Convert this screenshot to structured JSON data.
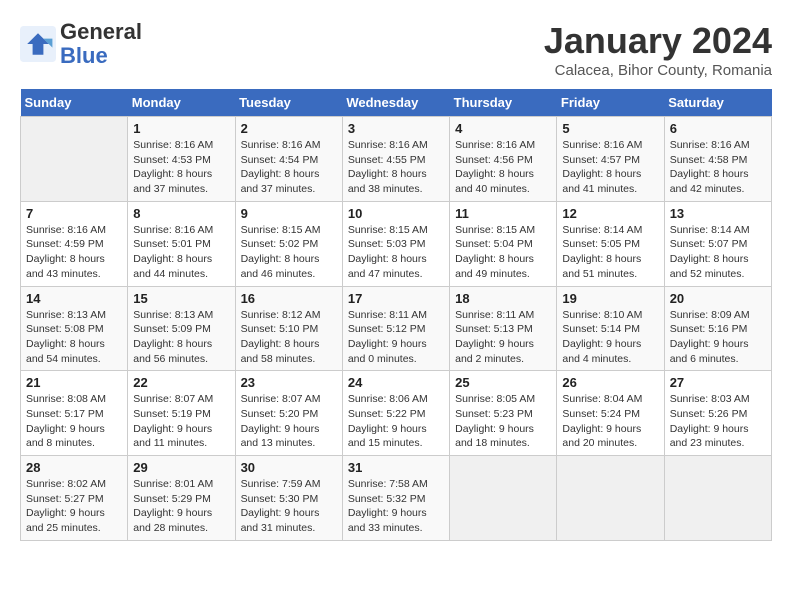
{
  "header": {
    "logo_line1": "General",
    "logo_line2": "Blue",
    "month": "January 2024",
    "location": "Calacea, Bihor County, Romania"
  },
  "days_of_week": [
    "Sunday",
    "Monday",
    "Tuesday",
    "Wednesday",
    "Thursday",
    "Friday",
    "Saturday"
  ],
  "weeks": [
    [
      {
        "day": "",
        "empty": true
      },
      {
        "day": "1",
        "sunrise": "Sunrise: 8:16 AM",
        "sunset": "Sunset: 4:53 PM",
        "daylight": "Daylight: 8 hours and 37 minutes."
      },
      {
        "day": "2",
        "sunrise": "Sunrise: 8:16 AM",
        "sunset": "Sunset: 4:54 PM",
        "daylight": "Daylight: 8 hours and 37 minutes."
      },
      {
        "day": "3",
        "sunrise": "Sunrise: 8:16 AM",
        "sunset": "Sunset: 4:55 PM",
        "daylight": "Daylight: 8 hours and 38 minutes."
      },
      {
        "day": "4",
        "sunrise": "Sunrise: 8:16 AM",
        "sunset": "Sunset: 4:56 PM",
        "daylight": "Daylight: 8 hours and 40 minutes."
      },
      {
        "day": "5",
        "sunrise": "Sunrise: 8:16 AM",
        "sunset": "Sunset: 4:57 PM",
        "daylight": "Daylight: 8 hours and 41 minutes."
      },
      {
        "day": "6",
        "sunrise": "Sunrise: 8:16 AM",
        "sunset": "Sunset: 4:58 PM",
        "daylight": "Daylight: 8 hours and 42 minutes."
      }
    ],
    [
      {
        "day": "7",
        "sunrise": "Sunrise: 8:16 AM",
        "sunset": "Sunset: 4:59 PM",
        "daylight": "Daylight: 8 hours and 43 minutes."
      },
      {
        "day": "8",
        "sunrise": "Sunrise: 8:16 AM",
        "sunset": "Sunset: 5:01 PM",
        "daylight": "Daylight: 8 hours and 44 minutes."
      },
      {
        "day": "9",
        "sunrise": "Sunrise: 8:15 AM",
        "sunset": "Sunset: 5:02 PM",
        "daylight": "Daylight: 8 hours and 46 minutes."
      },
      {
        "day": "10",
        "sunrise": "Sunrise: 8:15 AM",
        "sunset": "Sunset: 5:03 PM",
        "daylight": "Daylight: 8 hours and 47 minutes."
      },
      {
        "day": "11",
        "sunrise": "Sunrise: 8:15 AM",
        "sunset": "Sunset: 5:04 PM",
        "daylight": "Daylight: 8 hours and 49 minutes."
      },
      {
        "day": "12",
        "sunrise": "Sunrise: 8:14 AM",
        "sunset": "Sunset: 5:05 PM",
        "daylight": "Daylight: 8 hours and 51 minutes."
      },
      {
        "day": "13",
        "sunrise": "Sunrise: 8:14 AM",
        "sunset": "Sunset: 5:07 PM",
        "daylight": "Daylight: 8 hours and 52 minutes."
      }
    ],
    [
      {
        "day": "14",
        "sunrise": "Sunrise: 8:13 AM",
        "sunset": "Sunset: 5:08 PM",
        "daylight": "Daylight: 8 hours and 54 minutes."
      },
      {
        "day": "15",
        "sunrise": "Sunrise: 8:13 AM",
        "sunset": "Sunset: 5:09 PM",
        "daylight": "Daylight: 8 hours and 56 minutes."
      },
      {
        "day": "16",
        "sunrise": "Sunrise: 8:12 AM",
        "sunset": "Sunset: 5:10 PM",
        "daylight": "Daylight: 8 hours and 58 minutes."
      },
      {
        "day": "17",
        "sunrise": "Sunrise: 8:11 AM",
        "sunset": "Sunset: 5:12 PM",
        "daylight": "Daylight: 9 hours and 0 minutes."
      },
      {
        "day": "18",
        "sunrise": "Sunrise: 8:11 AM",
        "sunset": "Sunset: 5:13 PM",
        "daylight": "Daylight: 9 hours and 2 minutes."
      },
      {
        "day": "19",
        "sunrise": "Sunrise: 8:10 AM",
        "sunset": "Sunset: 5:14 PM",
        "daylight": "Daylight: 9 hours and 4 minutes."
      },
      {
        "day": "20",
        "sunrise": "Sunrise: 8:09 AM",
        "sunset": "Sunset: 5:16 PM",
        "daylight": "Daylight: 9 hours and 6 minutes."
      }
    ],
    [
      {
        "day": "21",
        "sunrise": "Sunrise: 8:08 AM",
        "sunset": "Sunset: 5:17 PM",
        "daylight": "Daylight: 9 hours and 8 minutes."
      },
      {
        "day": "22",
        "sunrise": "Sunrise: 8:07 AM",
        "sunset": "Sunset: 5:19 PM",
        "daylight": "Daylight: 9 hours and 11 minutes."
      },
      {
        "day": "23",
        "sunrise": "Sunrise: 8:07 AM",
        "sunset": "Sunset: 5:20 PM",
        "daylight": "Daylight: 9 hours and 13 minutes."
      },
      {
        "day": "24",
        "sunrise": "Sunrise: 8:06 AM",
        "sunset": "Sunset: 5:22 PM",
        "daylight": "Daylight: 9 hours and 15 minutes."
      },
      {
        "day": "25",
        "sunrise": "Sunrise: 8:05 AM",
        "sunset": "Sunset: 5:23 PM",
        "daylight": "Daylight: 9 hours and 18 minutes."
      },
      {
        "day": "26",
        "sunrise": "Sunrise: 8:04 AM",
        "sunset": "Sunset: 5:24 PM",
        "daylight": "Daylight: 9 hours and 20 minutes."
      },
      {
        "day": "27",
        "sunrise": "Sunrise: 8:03 AM",
        "sunset": "Sunset: 5:26 PM",
        "daylight": "Daylight: 9 hours and 23 minutes."
      }
    ],
    [
      {
        "day": "28",
        "sunrise": "Sunrise: 8:02 AM",
        "sunset": "Sunset: 5:27 PM",
        "daylight": "Daylight: 9 hours and 25 minutes."
      },
      {
        "day": "29",
        "sunrise": "Sunrise: 8:01 AM",
        "sunset": "Sunset: 5:29 PM",
        "daylight": "Daylight: 9 hours and 28 minutes."
      },
      {
        "day": "30",
        "sunrise": "Sunrise: 7:59 AM",
        "sunset": "Sunset: 5:30 PM",
        "daylight": "Daylight: 9 hours and 31 minutes."
      },
      {
        "day": "31",
        "sunrise": "Sunrise: 7:58 AM",
        "sunset": "Sunset: 5:32 PM",
        "daylight": "Daylight: 9 hours and 33 minutes."
      },
      {
        "day": "",
        "empty": true
      },
      {
        "day": "",
        "empty": true
      },
      {
        "day": "",
        "empty": true
      }
    ]
  ]
}
